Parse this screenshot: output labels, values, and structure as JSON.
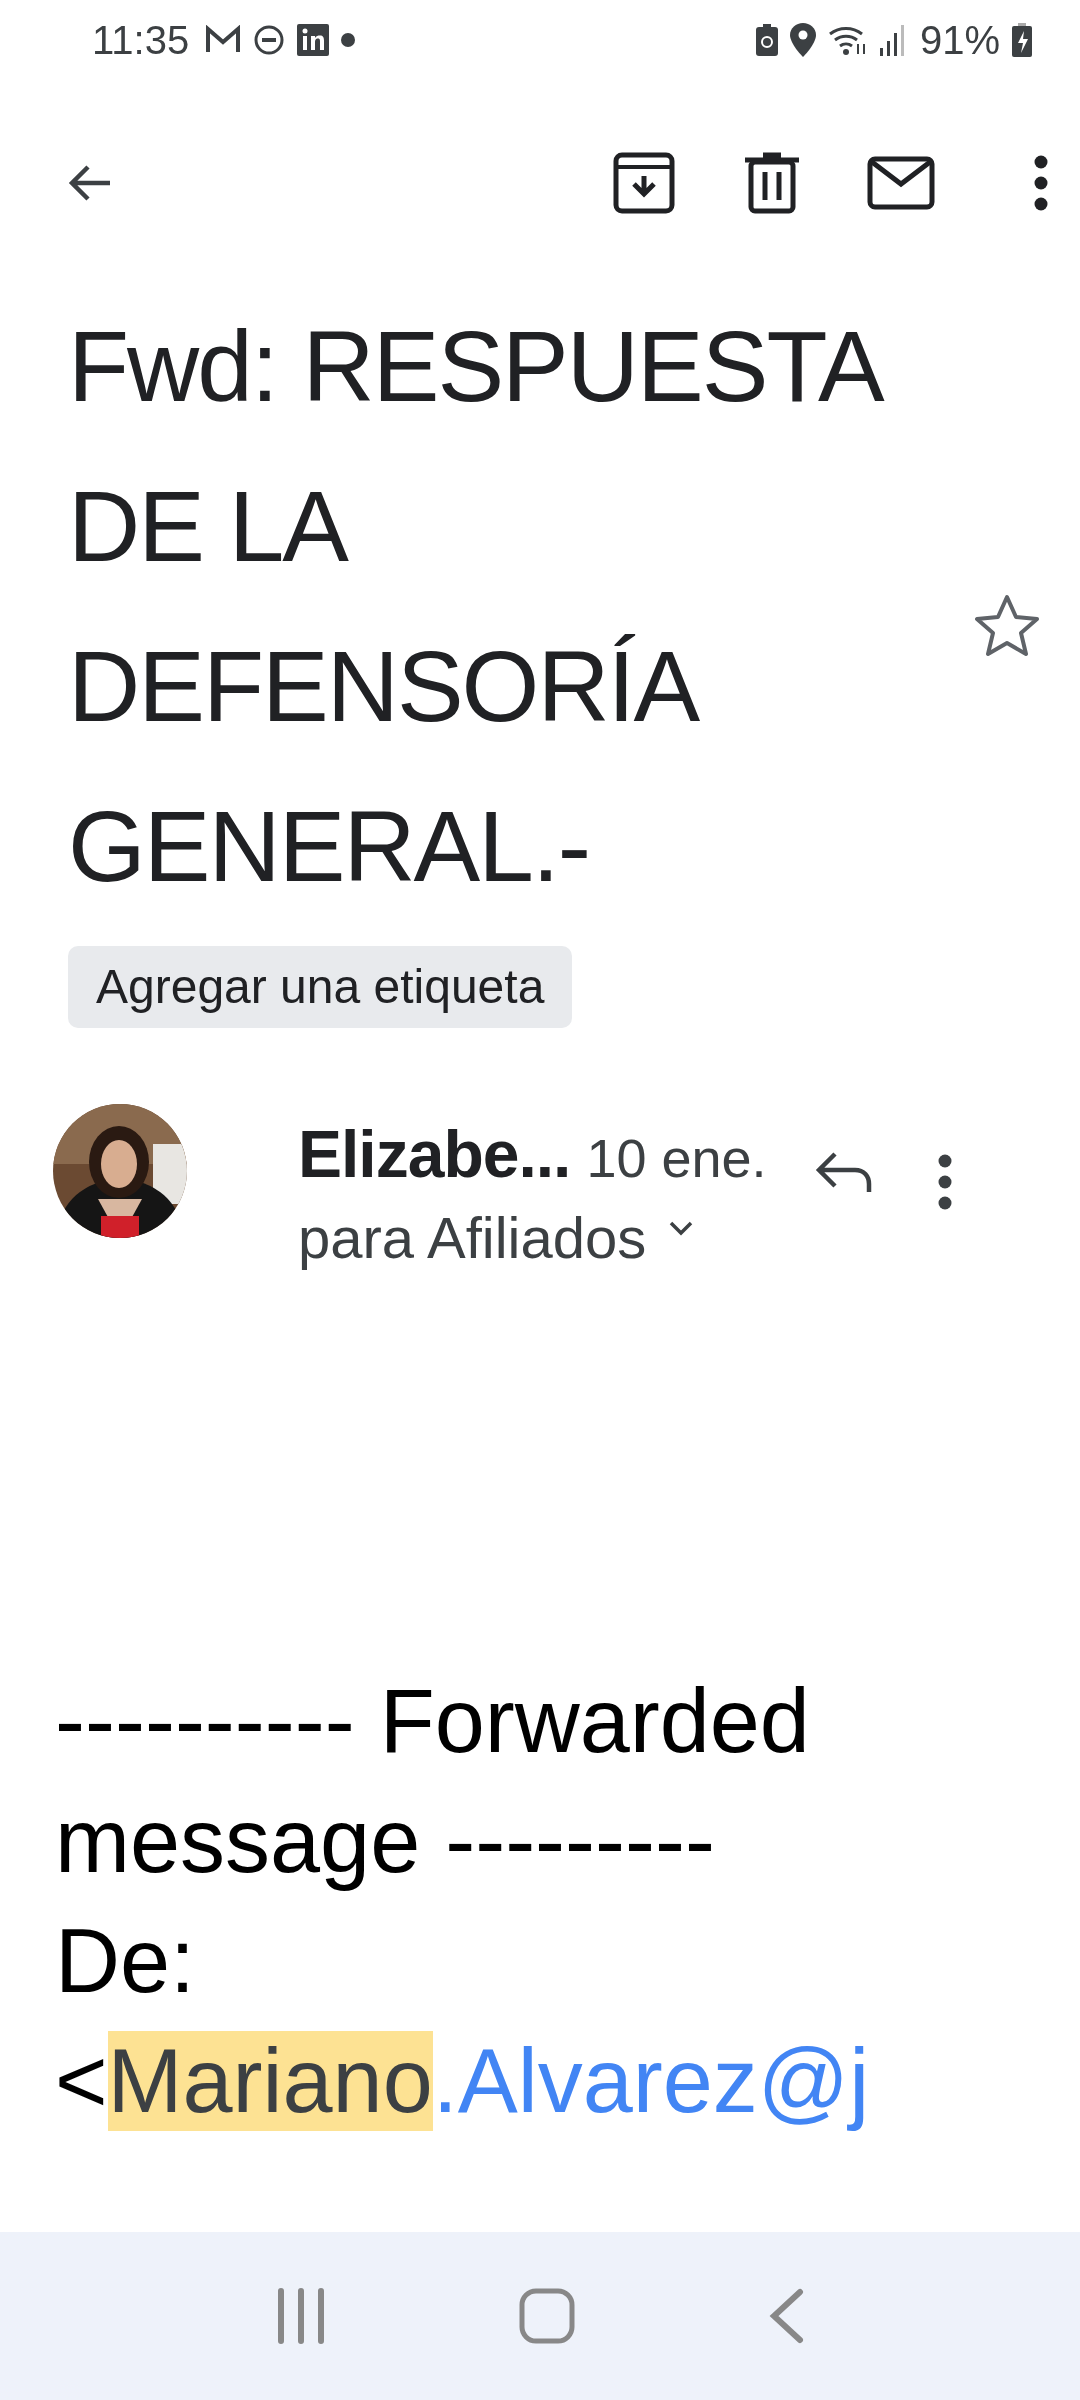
{
  "status_bar": {
    "time": "11:35",
    "battery": "91%"
  },
  "subject": {
    "lines": [
      "Fwd: RESPUESTA",
      "DE LA",
      "DEFENSORÍA",
      "GENERAL.-"
    ],
    "starred": false
  },
  "label_chip": "Agregar una etiqueta",
  "message": {
    "sender": "Elizabe...",
    "date": "10 ene.",
    "recipients": "para Afiliados"
  },
  "body": {
    "forward_header": "---------- Forwarded message ---------",
    "from_label": "De:",
    "email_prefix": "<",
    "email_highlight": "Mariano",
    "email_rest": ".Alvarez@j"
  }
}
